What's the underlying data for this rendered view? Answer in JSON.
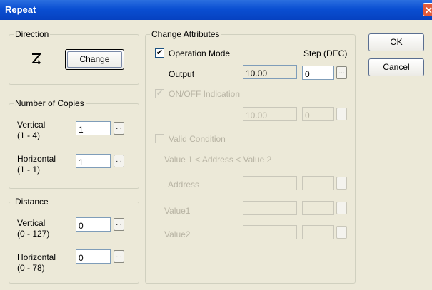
{
  "window": {
    "title": "Repeat",
    "close_icon": "close-icon"
  },
  "direction": {
    "legend": "Direction",
    "change_label": "Change",
    "direction_icon": "Z-arrow-icon"
  },
  "copies": {
    "legend": "Number of Copies",
    "vertical_label": "Vertical",
    "vertical_range": "(1 - 4)",
    "vertical_value": "1",
    "horizontal_label": "Horizontal",
    "horizontal_range": "(1 - 1)",
    "horizontal_value": "1",
    "browse_label": "..."
  },
  "distance": {
    "legend": "Distance",
    "vertical_label": "Vertical",
    "vertical_range": "(0 - 127)",
    "vertical_value": "0",
    "horizontal_label": "Horizontal",
    "horizontal_range": "(0 - 78)",
    "horizontal_value": "0",
    "browse_label": "..."
  },
  "change_attributes": {
    "legend": "Change Attributes",
    "operation_mode": {
      "label": "Operation Mode",
      "checked": true,
      "check_mark": "✔"
    },
    "step_label": "Step (DEC)",
    "output_label": "Output",
    "output_value": "10.00",
    "output_step": "0",
    "onoff": {
      "label": "ON/OFF Indication",
      "checked": true,
      "check_mark": "✔",
      "value": "10.00",
      "step": "0"
    },
    "valid_condition": {
      "label": "Valid Condition",
      "checked": false
    },
    "condition_text": "Value 1 < Address < Value 2",
    "address_label": "Address",
    "value1_label": "Value1",
    "value2_label": "Value2",
    "browse_label": "..."
  },
  "buttons": {
    "ok": "OK",
    "cancel": "Cancel"
  }
}
